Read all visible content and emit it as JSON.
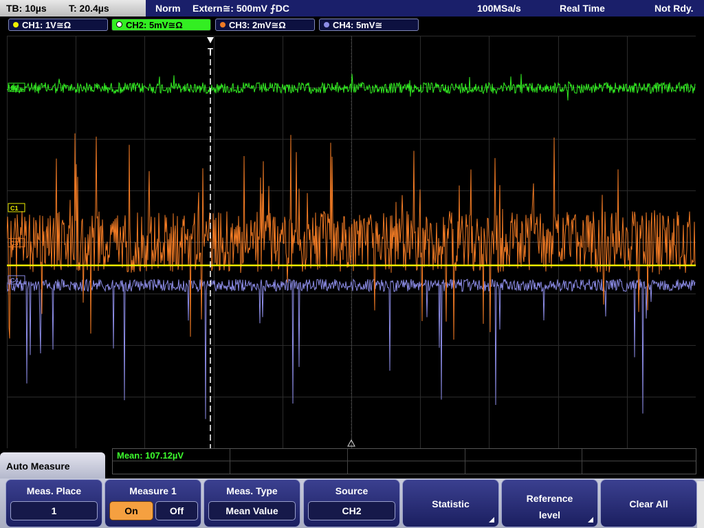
{
  "status": {
    "timebase": "TB: 10µs",
    "trigger_time": "T: 20.4µs",
    "mode": "Norm",
    "trigger_source": "Extern≅: 500mV ⨍DC",
    "sample_rate": "100MSa/s",
    "acquisition": "Real Time",
    "ready": "Not Rdy."
  },
  "channels": [
    {
      "label": "CH1: 1V≅Ω",
      "color": "#f0f000",
      "marker": "C1",
      "active": false
    },
    {
      "label": "CH2: 5mV≅Ω",
      "color": "#33ee22",
      "marker": "C2",
      "active": true
    },
    {
      "label": "CH3: 2mV≅Ω",
      "color": "#f07a24",
      "marker": "C3",
      "active": false
    },
    {
      "label": "CH4: 5mV≅",
      "color": "#8c8ce6",
      "marker": "C4",
      "active": false
    }
  ],
  "trigger_marker": "T",
  "measurement": {
    "result": "Mean: 107.12µV"
  },
  "menu": {
    "title": "Auto Measure",
    "keys": [
      {
        "label": "Meas. Place",
        "value": "1"
      },
      {
        "label": "Measure 1",
        "on": "On",
        "off": "Off"
      },
      {
        "label": "Meas. Type",
        "value": "Mean Value"
      },
      {
        "label": "Source",
        "value": "CH2"
      },
      {
        "label": "Statistic"
      },
      {
        "label": "Reference level"
      },
      {
        "label": "Clear All"
      }
    ]
  }
}
